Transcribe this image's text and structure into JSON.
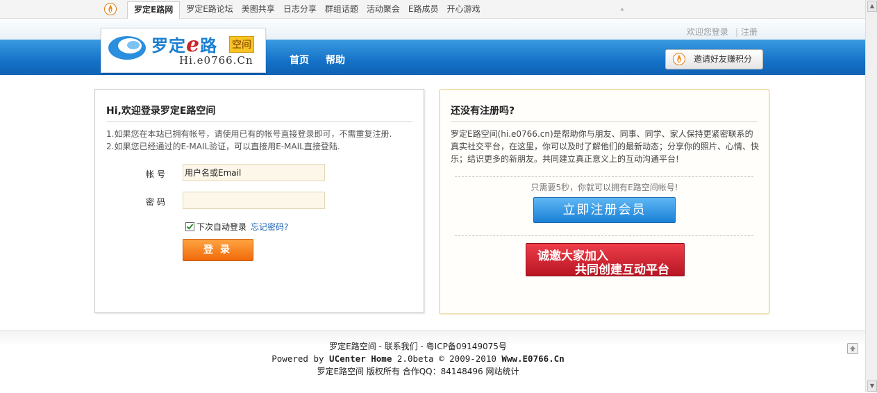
{
  "topnav": {
    "tabs": [
      {
        "label": "罗定E路网",
        "active": true
      },
      {
        "label": "罗定E路论坛"
      },
      {
        "label": "美图共享"
      },
      {
        "label": "日志分享"
      },
      {
        "label": "群组话题"
      },
      {
        "label": "活动聚会"
      },
      {
        "label": "E路成员"
      },
      {
        "label": "开心游戏"
      }
    ]
  },
  "header": {
    "brand": {
      "name_prefix": "罗定",
      "name_e": "e",
      "name_suffix": "路",
      "tag": "空间",
      "url": "Hi.e0766.Cn"
    },
    "userlinks": {
      "welcome": "欢迎您登录",
      "register": "注册"
    },
    "nav": {
      "home": "首页",
      "help": "帮助"
    },
    "invite": "邀请好友赚积分"
  },
  "login": {
    "title": "Hi,欢迎登录罗定E路空间",
    "tip1": "1.如果您在本站已拥有帐号，请使用已有的帐号直接登录即可，不需重复注册.",
    "tip2": "2.如果您已经通过的E-MAIL验证，可以直接用E-MAIL直接登陆.",
    "username_label": "帐号",
    "username_value": "用户名或Email",
    "password_label": "密码",
    "password_value": "",
    "remember_label": "下次自动登录",
    "remember_checked": true,
    "forgot": "忘记密码?",
    "submit": "登录"
  },
  "register": {
    "title": "还没有注册吗?",
    "intro": "罗定E路空间(hi.e0766.cn)是帮助你与朋友、同事、同学、家人保持更紧密联系的真实社交平台，在这里，你可以及时了解他们的最新动态；分享你的照片、心情、快乐；结识更多的新朋友。共同建立真正意义上的互动沟通平台!",
    "need": "只需要5秒，你就可以拥有E路空间帐号!",
    "button": "立即注册会员",
    "banner_line1": "诚邀大家加入",
    "banner_line2": "共同创建互动平台"
  },
  "footer": {
    "site": "罗定E路空间",
    "contact": "联系我们",
    "icp": "粤ICP备09149075号",
    "powered_prefix": "Powered by",
    "product": "UCenter Home",
    "version": "2.0beta © 2009-2010",
    "domain": "Www.E0766.Cn",
    "line3_site": "罗定E路空间",
    "rights": "版权所有",
    "qq": "合作QQ：84148496",
    "stats": "网站统计"
  },
  "colors": {
    "header_blue": "#1572c8",
    "login_orange": "#f06a0a",
    "register_blue": "#1a80d6",
    "banner_red": "#b81523"
  }
}
